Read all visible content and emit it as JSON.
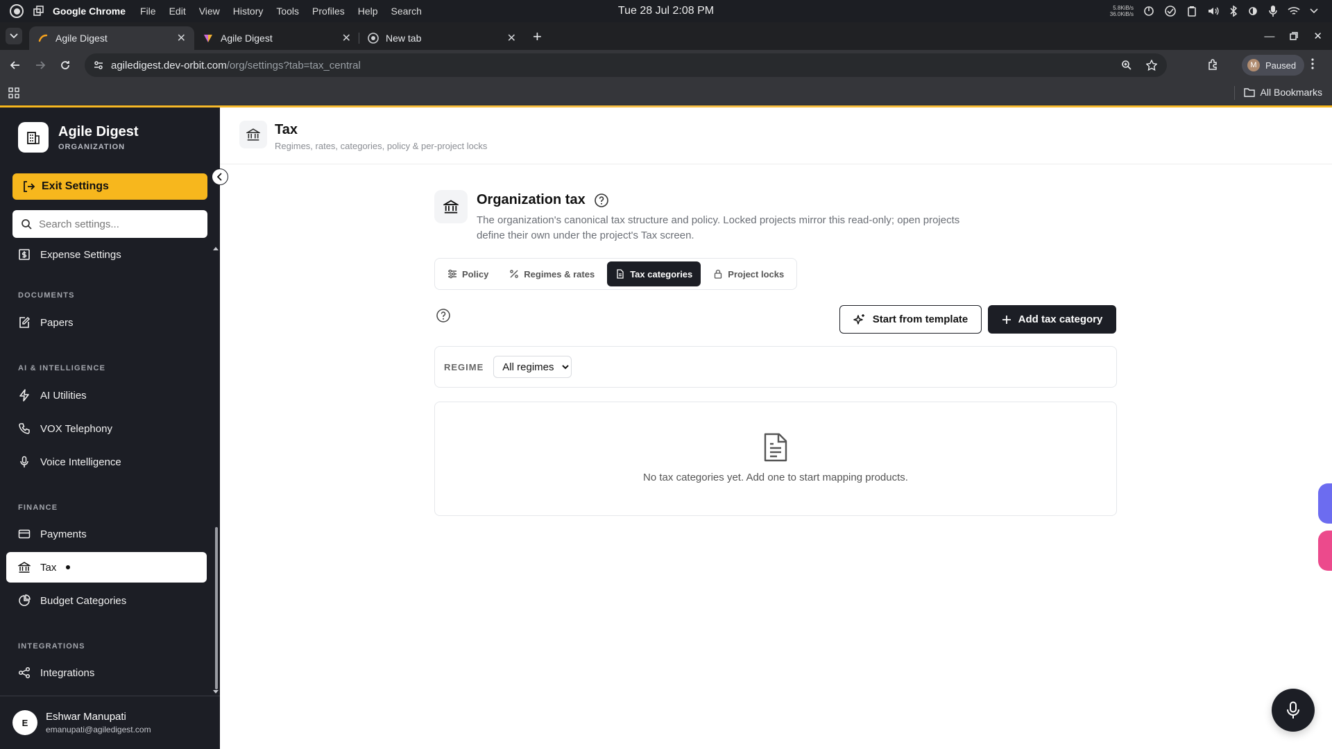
{
  "os": {
    "app_name": "Google Chrome",
    "menu": [
      "File",
      "Edit",
      "View",
      "History",
      "Tools",
      "Profiles",
      "Help",
      "Search"
    ],
    "clock": "Tue 28 Jul  2:08 PM",
    "net_up": "5.8KiB/s",
    "net_down": "36.0KiB/s"
  },
  "browser": {
    "tabs": [
      {
        "title": "Agile Digest",
        "active": true
      },
      {
        "title": "Agile Digest",
        "active": false
      },
      {
        "title": "New tab",
        "active": false
      }
    ],
    "url_host": "agiledigest.dev-orbit.com",
    "url_path": "/org/settings?tab=tax_central",
    "profile_initial": "M",
    "profile_status": "Paused",
    "bookmarks_label": "All Bookmarks"
  },
  "sidebar": {
    "org_name": "Agile Digest",
    "org_type": "ORGANIZATION",
    "exit_label": "Exit Settings",
    "search_placeholder": "Search settings...",
    "items": {
      "expense": "Expense Settings",
      "documents_section": "DOCUMENTS",
      "papers": "Papers",
      "ai_section": "AI & INTELLIGENCE",
      "ai_utilities": "AI Utilities",
      "vox": "VOX Telephony",
      "voice": "Voice Intelligence",
      "finance_section": "FINANCE",
      "payments": "Payments",
      "tax": "Tax",
      "budget": "Budget Categories",
      "integrations_section": "INTEGRATIONS",
      "integrations": "Integrations"
    },
    "user": {
      "initial": "E",
      "name": "Eshwar Manupati",
      "email": "emanupati@agiledigest.com"
    }
  },
  "page": {
    "title": "Tax",
    "subtitle": "Regimes, rates, categories, policy & per-project locks"
  },
  "section": {
    "title": "Organization tax",
    "description": "The organization's canonical tax structure and policy. Locked projects mirror this read-only; open projects define their own under the project's Tax screen.",
    "tabs": {
      "policy": "Policy",
      "regimes": "Regimes & rates",
      "categories": "Tax categories",
      "locks": "Project locks"
    },
    "template_button": "Start from template",
    "add_button": "Add tax category",
    "filter_label": "REGIME",
    "regime_selected": "All regimes",
    "empty_message": "No tax categories yet. Add one to start mapping products."
  },
  "colors": {
    "accent": "#f7b71d",
    "sidebar_bg": "#1c1e25",
    "dark_button": "#1c1e25"
  }
}
